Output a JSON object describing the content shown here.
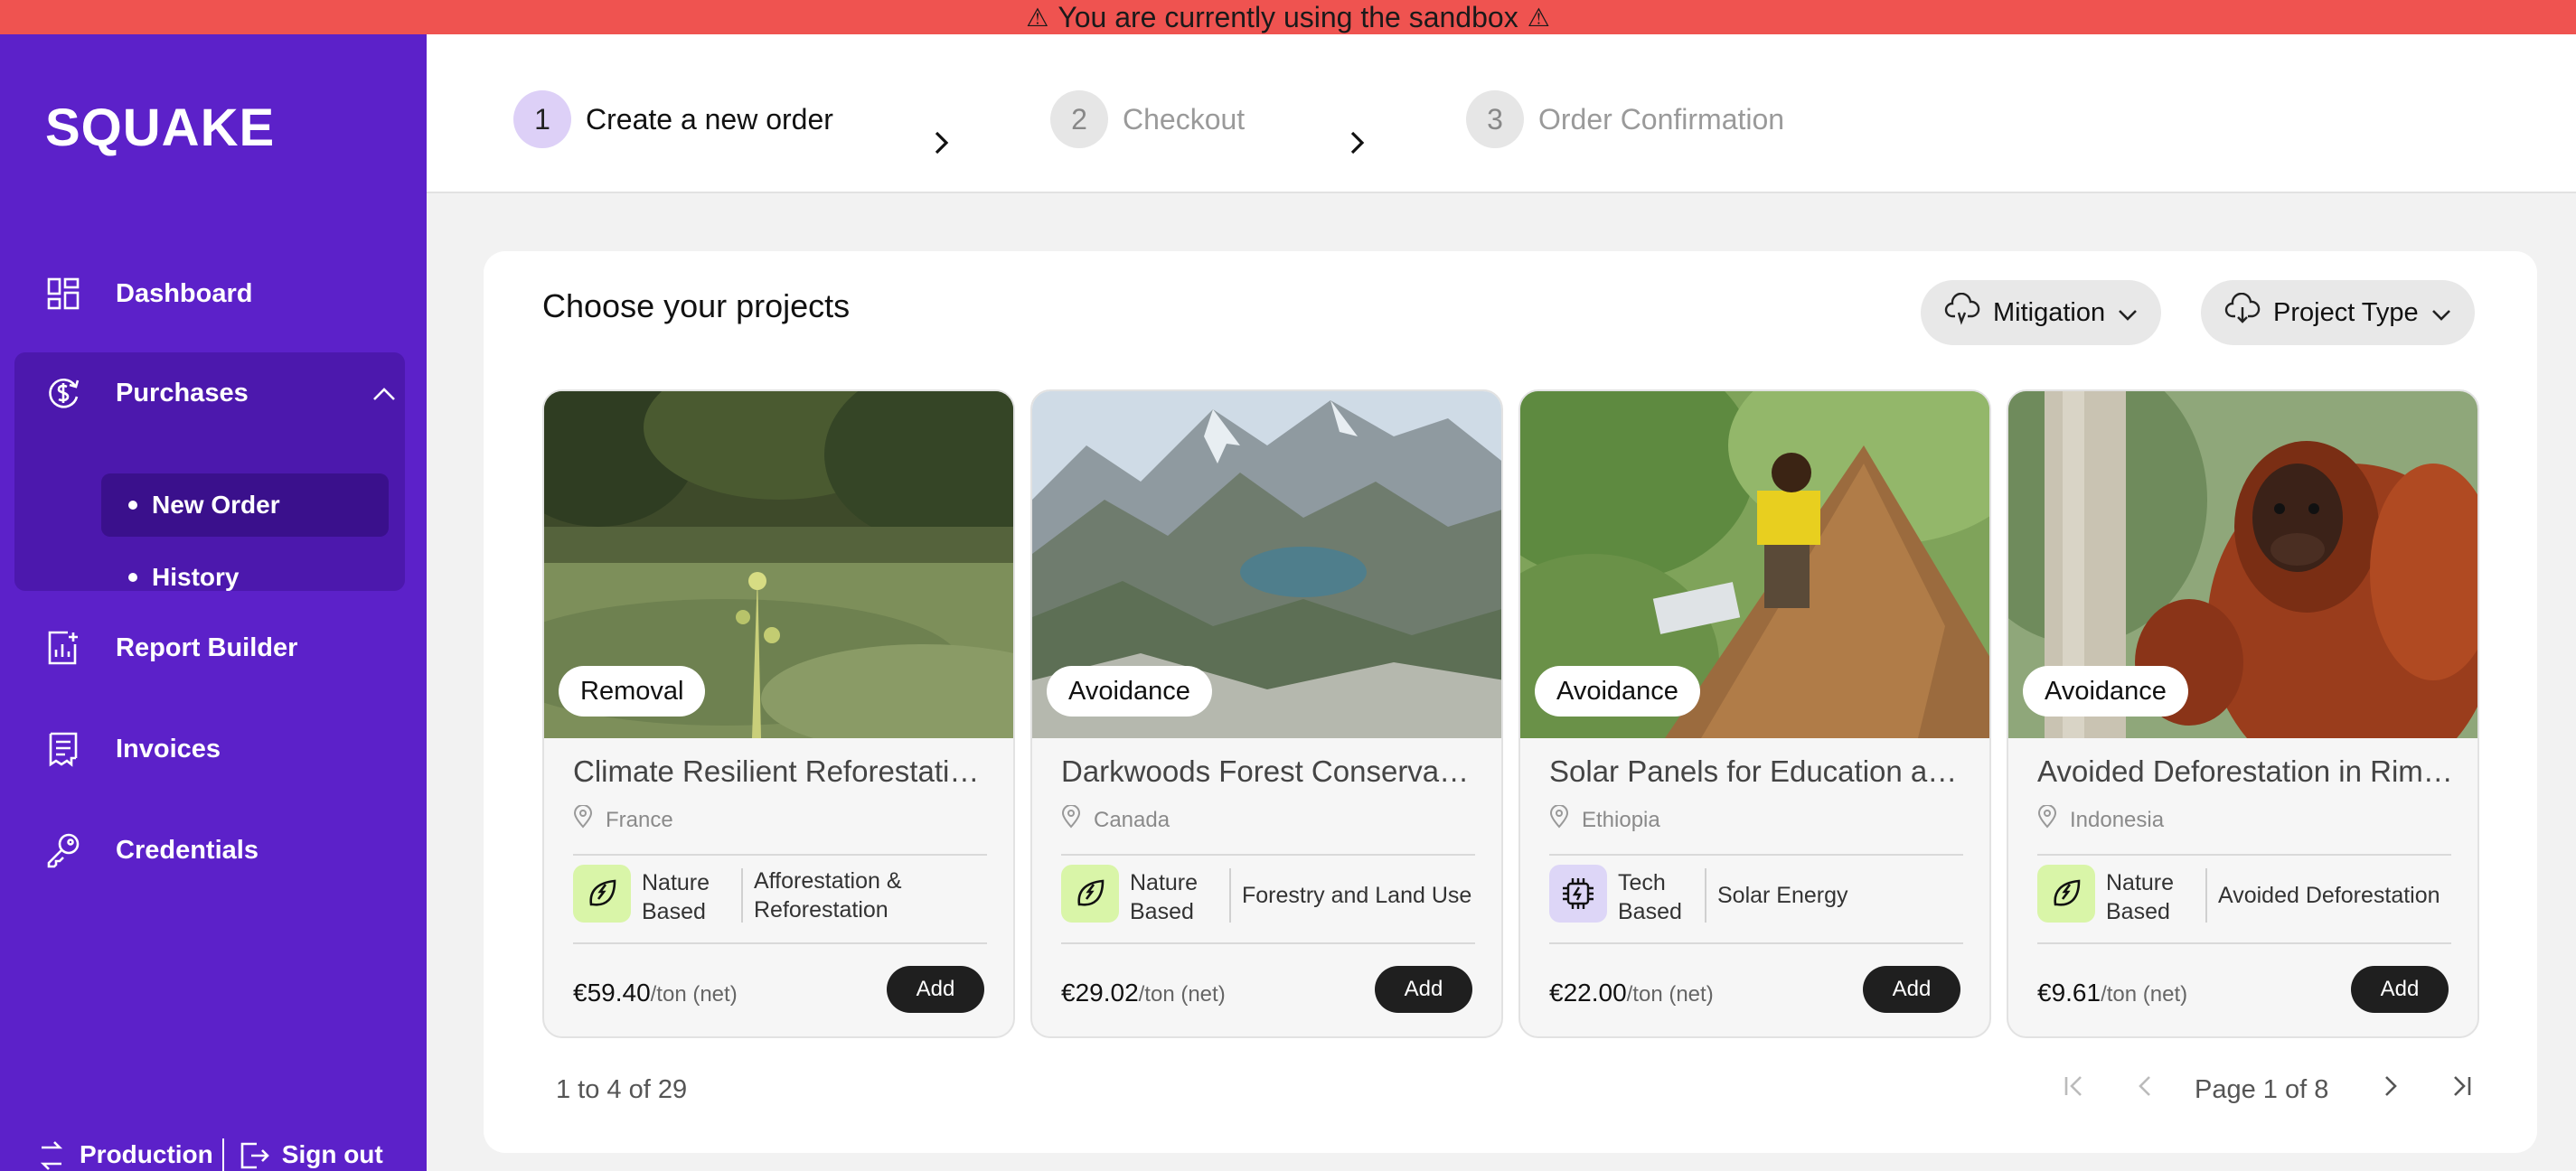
{
  "banner": {
    "warn_left": "⚠",
    "text": "You are currently using the sandbox",
    "warn_right": "⚠"
  },
  "sidebar": {
    "logo": "SQUAKE",
    "items": [
      {
        "label": "Dashboard",
        "icon": "dashboard-icon"
      },
      {
        "label": "Purchases",
        "icon": "purchases-icon"
      },
      {
        "label": "Report Builder",
        "icon": "report-builder-icon"
      },
      {
        "label": "Invoices",
        "icon": "invoices-icon"
      },
      {
        "label": "Credentials",
        "icon": "key-icon"
      }
    ],
    "sub_items": [
      {
        "label": "New Order",
        "active": true
      },
      {
        "label": "History",
        "active": false
      }
    ],
    "bottom": {
      "production": "Production",
      "sign_out": "Sign out"
    }
  },
  "stepper": {
    "steps": [
      {
        "number": "1",
        "label": "Create a new order",
        "active": true
      },
      {
        "number": "2",
        "label": "Checkout",
        "active": false
      },
      {
        "number": "3",
        "label": "Order Confirmation",
        "active": false
      }
    ]
  },
  "main": {
    "title": "Choose your projects",
    "filters": [
      {
        "label": "Mitigation",
        "icon": "cloud-icon"
      },
      {
        "label": "Project Type",
        "icon": "cloud-download-icon"
      }
    ],
    "projects": [
      {
        "tag": "Removal",
        "title": "Climate Resilient Reforestation Kenya",
        "location": "France",
        "category_line1": "Nature",
        "category_line2": "Based",
        "category_icon": "leaf-icon",
        "subcategory_line1": "Afforestation &",
        "subcategory_line2": "Reforestation",
        "price": "€59.40",
        "unit": "/ton (net)",
        "add_label": "Add",
        "image": "seedling-field"
      },
      {
        "tag": "Avoidance",
        "title": "Darkwoods Forest Conservation",
        "location": "Canada",
        "category_line1": "Nature",
        "category_line2": "Based",
        "category_icon": "leaf-icon",
        "subcategory_line1": "Forestry and Land Use",
        "subcategory_line2": "",
        "price": "€29.02",
        "unit": "/ton (net)",
        "add_label": "Add",
        "image": "mountain-lake"
      },
      {
        "tag": "Avoidance",
        "title": "Solar Panels for Education and Health",
        "location": "Ethiopia",
        "category_line1": "Tech",
        "category_line2": "Based",
        "category_icon": "chip-icon",
        "subcategory_line1": "Solar Energy",
        "subcategory_line2": "",
        "price": "€22.00",
        "unit": "/ton (net)",
        "add_label": "Add",
        "image": "solar-hut"
      },
      {
        "tag": "Avoidance",
        "title": "Avoided Deforestation in Rimba Raya",
        "location": "Indonesia",
        "category_line1": "Nature",
        "category_line2": "Based",
        "category_icon": "leaf-icon",
        "subcategory_line1": "Avoided Deforestation",
        "subcategory_line2": "",
        "price": "€9.61",
        "unit": "/ton (net)",
        "add_label": "Add",
        "image": "orangutan"
      }
    ],
    "pagination": {
      "range": "1 to 4 of 29",
      "page_text": "Page 1 of 8"
    }
  },
  "colors": {
    "sidebar": "#5c21c9",
    "sidebar_group": "#4c18ad",
    "banner": "#ef5350",
    "nature_badge": "#d9f5a8",
    "tech_badge": "#ddd6f7"
  }
}
